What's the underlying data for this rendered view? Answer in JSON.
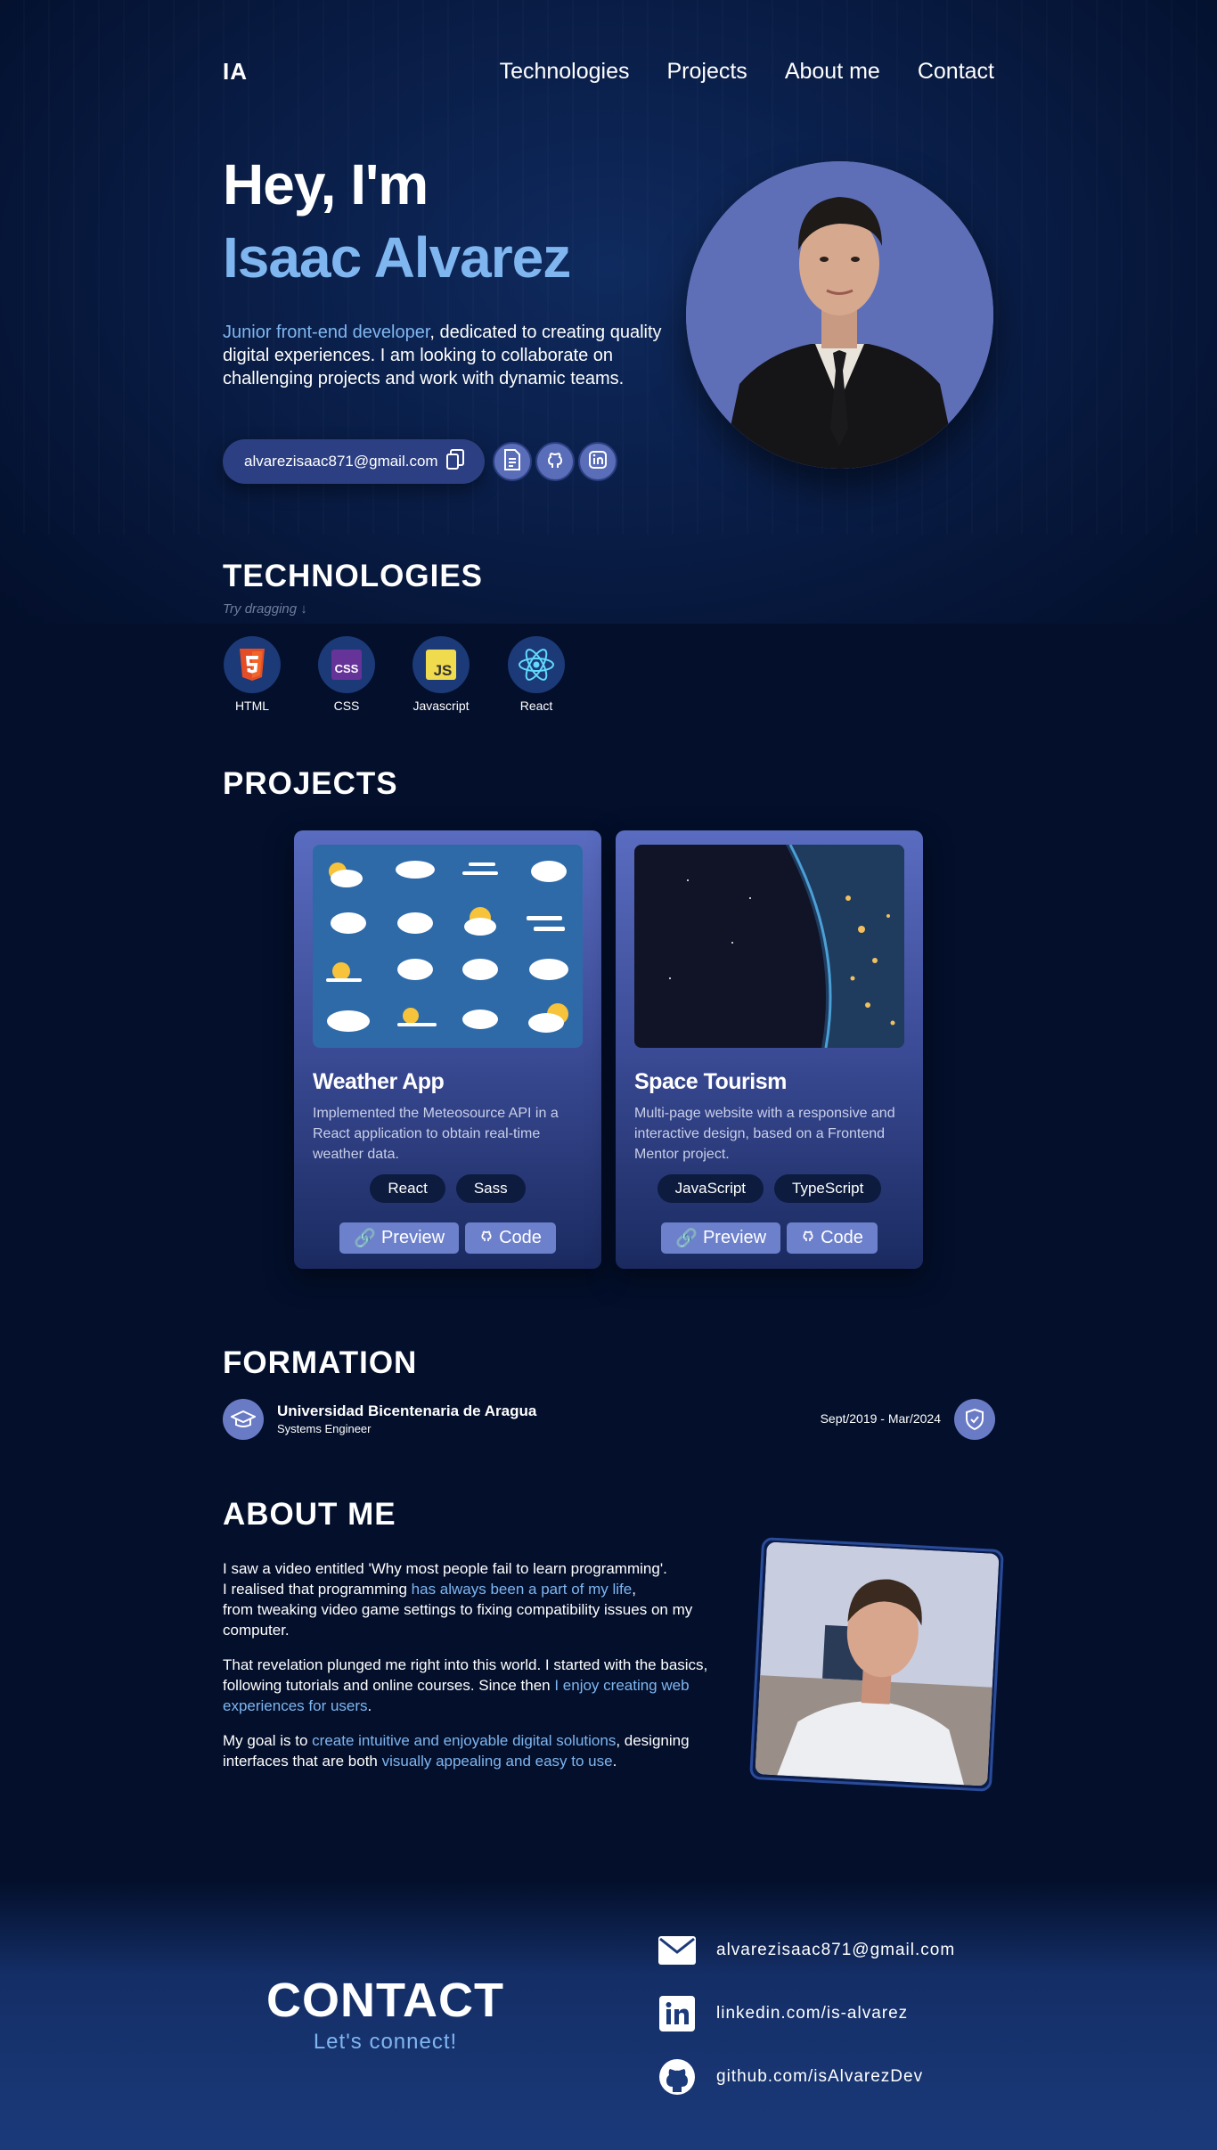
{
  "nav": {
    "logo": "IA",
    "links": [
      "Technologies",
      "Projects",
      "About me",
      "Contact"
    ]
  },
  "hero": {
    "greeting": "Hey, I'm",
    "name": "Isaac Alvarez",
    "role": "Junior front-end developer",
    "description_rest": ", dedicated to creating quality digital experiences. I am looking to collaborate on challenging projects and work with dynamic teams.",
    "email": "alvarezisaac871@gmail.com",
    "photo_bg": "#5e6fb8"
  },
  "technologies": {
    "title": "TECHNOLOGIES",
    "hint": "Try dragging",
    "items": [
      {
        "label": "HTML",
        "icon": "html5-icon"
      },
      {
        "label": "CSS",
        "icon": "css-icon"
      },
      {
        "label": "Javascript",
        "icon": "js-icon"
      },
      {
        "label": "React",
        "icon": "react-icon"
      }
    ]
  },
  "projects": {
    "title": "PROJECTS",
    "cards": [
      {
        "title": "Weather App",
        "description": "Implemented the Meteosource API in a React application to obtain real-time weather data.",
        "tags": [
          "React",
          "Sass"
        ],
        "preview": "Preview",
        "code": "Code"
      },
      {
        "title": "Space Tourism",
        "description": "Multi-page website with a responsive and interactive design, based on a Frontend Mentor project.",
        "tags": [
          "JavaScript",
          "TypeScript"
        ],
        "preview": "Preview",
        "code": "Code"
      }
    ]
  },
  "formation": {
    "title": "FORMATION",
    "institution": "Universidad Bicentenaria de Aragua",
    "degree": "Systems Engineer",
    "dates": "Sept/2019 - Mar/2024"
  },
  "about": {
    "title": "ABOUT ME",
    "p1_a": "I saw a video entitled 'Why most people fail to learn programming'.",
    "p1_b": "I realised that programming ",
    "p1_hl": "has always been a part of my life",
    "p1_c": ",",
    "p1_d": "from tweaking video game settings to fixing compatibility issues on my computer.",
    "p2_a": "That revelation plunged me right into this world. I started with the basics, following tutorials and online courses. Since then ",
    "p2_hl": "I enjoy creating web experiences for users",
    "p2_b": ".",
    "p3_a": "My goal is to ",
    "p3_hl1": "create intuitive and enjoyable digital solutions",
    "p3_b": ", designing interfaces that are both ",
    "p3_hl2": "visually appealing and easy to use",
    "p3_c": "."
  },
  "contact": {
    "title": "CONTACT",
    "subtitle": "Let's connect!",
    "email": "alvarezisaac871@gmail.com",
    "linkedin": "linkedin.com/is-alvarez",
    "github": "github.com/isAlvarezDev"
  },
  "colors": {
    "accent": "#7fb6f0",
    "background": "#030f2b",
    "card": "#4a5cab"
  }
}
